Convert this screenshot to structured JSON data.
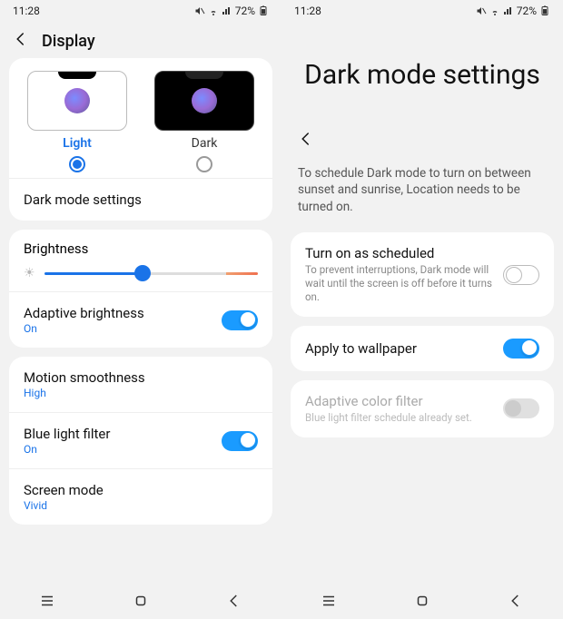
{
  "left": {
    "status": {
      "time": "11:28",
      "battery": "72%"
    },
    "header": {
      "title": "Display"
    },
    "theme": {
      "light_label": "Light",
      "dark_label": "Dark"
    },
    "dark_mode_settings": "Dark mode settings",
    "brightness_label": "Brightness",
    "adaptive": {
      "label": "Adaptive brightness",
      "status": "On"
    },
    "motion": {
      "label": "Motion smoothness",
      "status": "High"
    },
    "bluelight": {
      "label": "Blue light filter",
      "status": "On"
    },
    "screenmode": {
      "label": "Screen mode",
      "status": "Vivid"
    }
  },
  "right": {
    "status": {
      "time": "11:28",
      "battery": "72%"
    },
    "title": "Dark mode settings",
    "intro": "To schedule Dark mode to turn on between sunset and sunrise, Location needs to be turned on.",
    "scheduled": {
      "label": "Turn on as scheduled",
      "desc": "To prevent interruptions, Dark mode will wait until the screen is off before it turns on."
    },
    "wallpaper": {
      "label": "Apply to wallpaper"
    },
    "colorfilter": {
      "label": "Adaptive color filter",
      "desc": "Blue light filter schedule already set."
    }
  }
}
